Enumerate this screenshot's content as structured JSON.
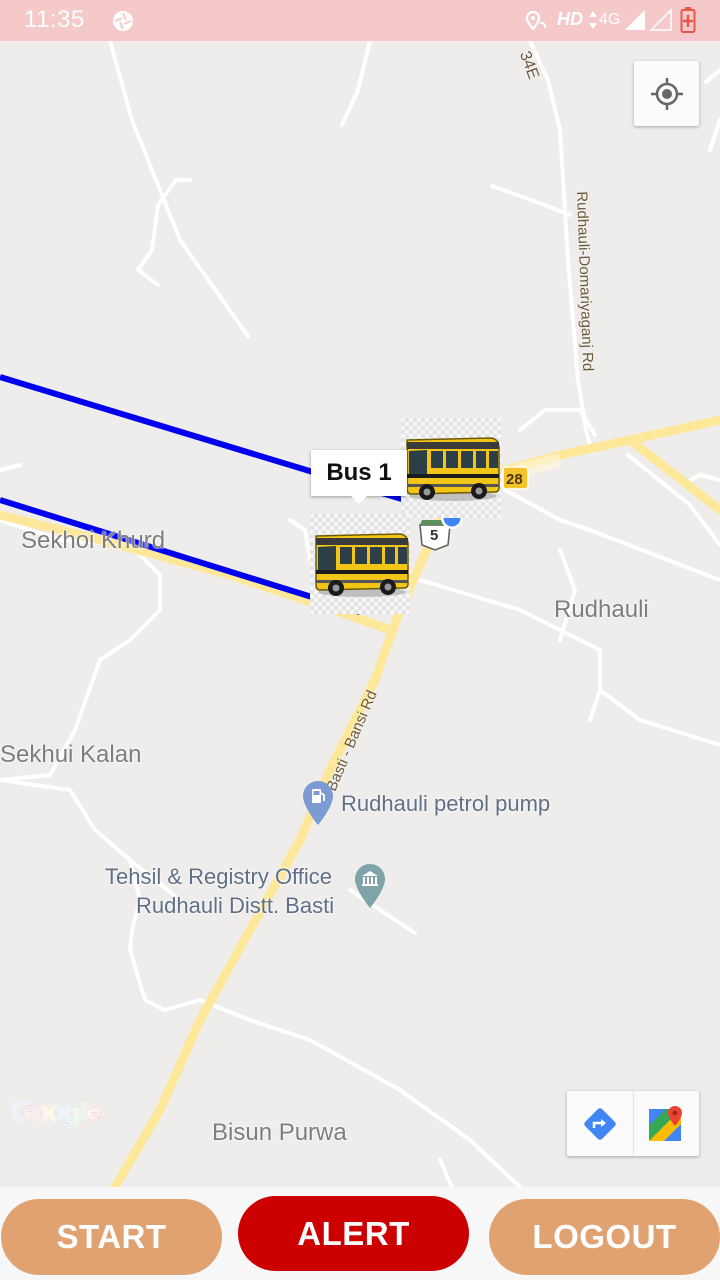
{
  "status_bar": {
    "time": "11:35",
    "network_hd": "HD",
    "network_type": "4G",
    "background": "#f5c9c9"
  },
  "map": {
    "places": {
      "sekhoi_khurd": "Sekhoi Khurd",
      "rudhauli": "Rudhauli",
      "sekhui_kalan": "Sekhui Kalan",
      "bisun_purwa": "Bisun Purwa"
    },
    "pois": {
      "petrol_pump": "Rudhauli petrol pump",
      "tehsil_line1": "Tehsil & Registry Office",
      "tehsil_line2": "Rudhauli Distt. Basti"
    },
    "roads": {
      "basti_bansi": "Basti - Bansi Rd",
      "rudhauli_domariyaganj": "Rudhauli-Domariyaganj Rd",
      "road_34e": "34E"
    },
    "shields": {
      "route_28": "28",
      "route_5": "5"
    },
    "info_window": "Bus 1",
    "google_logo": "Google",
    "route_color": "#0000ee"
  },
  "buttons": {
    "start": "START",
    "alert": "ALERT",
    "logout": "LOGOUT"
  }
}
